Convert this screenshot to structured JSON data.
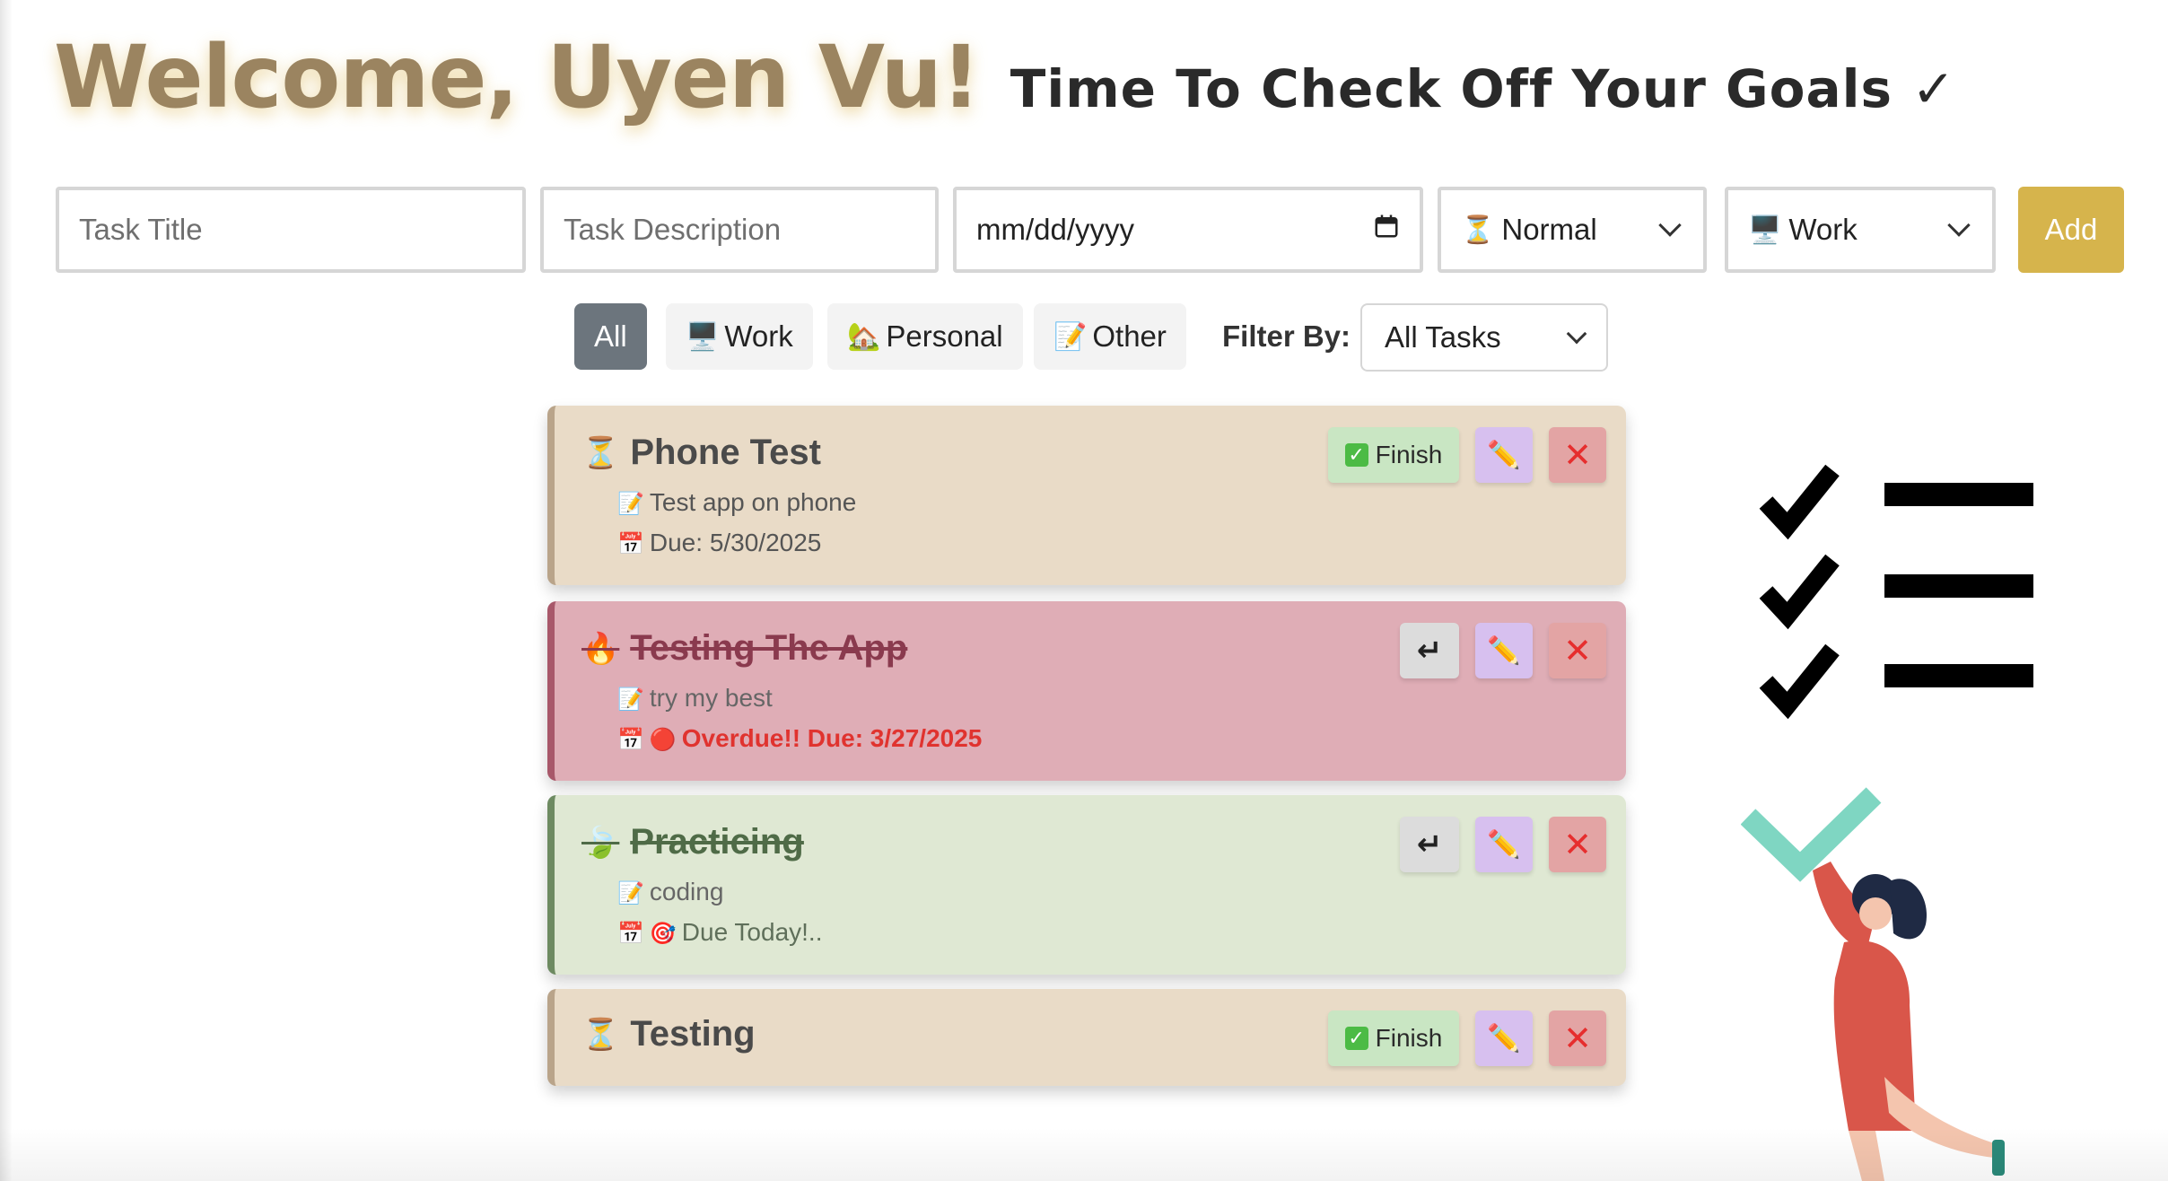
{
  "header": {
    "welcome": "Welcome, Uyen Vu!",
    "subtitle": "Time To Check Off Your Goals ✓"
  },
  "form": {
    "title_placeholder": "Task Title",
    "description_placeholder": "Task Description",
    "date_placeholder": "mm/dd/yyyy",
    "priority_value": "Normal",
    "priority_icon": "hourglass-icon",
    "category_value": "Work",
    "category_icon": "computer-icon",
    "add_label": "Add"
  },
  "filters": {
    "all": "All",
    "work": "Work",
    "personal": "Personal",
    "other": "Other",
    "filter_by_label": "Filter By:",
    "filter_value": "All Tasks"
  },
  "tasks": [
    {
      "title": "Phone Test",
      "status_icon": "⏳",
      "completed": false,
      "description": "Test app on phone",
      "due": "Due: 5/30/2025",
      "finish_label": "Finish"
    },
    {
      "title": "Testing The App",
      "status_icon": "🔥",
      "completed": true,
      "description": "try my best",
      "due": "Overdue!! Due: 3/27/2025"
    },
    {
      "title": "Practicing",
      "status_icon": "🍃",
      "completed": true,
      "description": "coding",
      "due": "Due Today!.."
    },
    {
      "title": "Testing",
      "status_icon": "⏳",
      "completed": false,
      "finish_label": "Finish"
    }
  ],
  "colors": {
    "accent_gold": "#d6b44c",
    "welcome_text": "#9b8460",
    "pending_card": "#e9dbc7",
    "overdue_card": "#dfadb6",
    "today_card": "#dfe8d3",
    "active_chip": "#6c757d"
  }
}
